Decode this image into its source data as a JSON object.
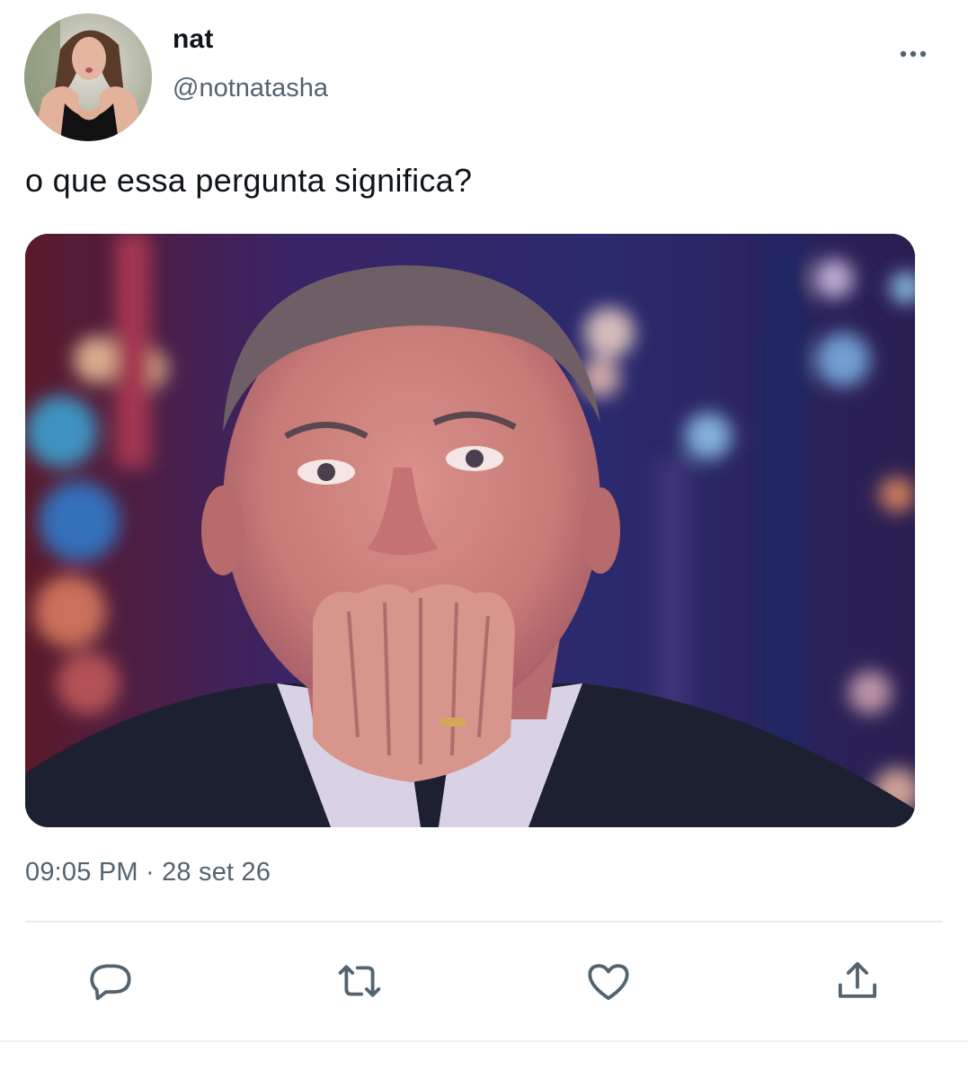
{
  "user": {
    "display_name": "nat",
    "handle": "@notnatasha",
    "avatar_icon": "profile-photo"
  },
  "tweet": {
    "text": "o que essa pergunta significa?",
    "timestamp": "09:05 PM · 28 set 26",
    "media_description_icon": "photo"
  },
  "actions": [
    {
      "name": "reply",
      "icon": "speech-bubble-icon"
    },
    {
      "name": "retweet",
      "icon": "retweet-arrows-icon"
    },
    {
      "name": "like",
      "icon": "heart-icon"
    },
    {
      "name": "share",
      "icon": "upload-share-icon"
    }
  ],
  "colors": {
    "text_primary": "#0f1419",
    "text_secondary": "#536471",
    "icon_gray": "#536471",
    "divider": "#e7ebee",
    "background": "#ffffff"
  }
}
